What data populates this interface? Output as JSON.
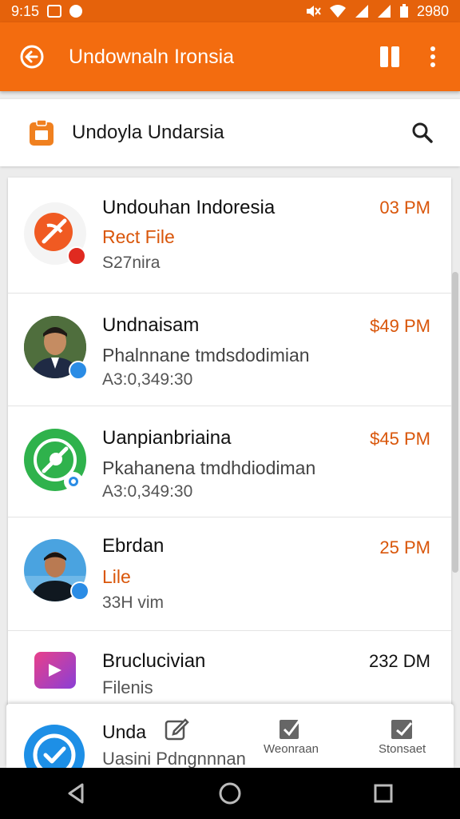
{
  "status_bar": {
    "time": "9:15",
    "battery": "2980"
  },
  "app_bar": {
    "title": "Undownaln Ironsia"
  },
  "search_bar": {
    "text": "Undoyla Undarsia"
  },
  "items": [
    {
      "name": "Undouhan Indoresia",
      "subtitle": "Rect File",
      "meta": "S27nira",
      "time": "03 PM"
    },
    {
      "name": "Undnaisam",
      "subtitle": "Phalnnane tmdsdodimian",
      "meta": "A3:0,349:30",
      "time": "$49 PM"
    },
    {
      "name": "Uanpianbriaina",
      "subtitle": "Pkahanena tmdhdiodiman",
      "meta": "A3:0,349:30",
      "time": "$45 PM"
    },
    {
      "name": "Ebrdan",
      "subtitle": "Lile",
      "meta": "33H vim",
      "time": "25 PM"
    },
    {
      "name": "Bruclucivian",
      "subtitle": "Filenis",
      "meta": "",
      "time": "232 DM"
    }
  ],
  "bottom_card": {
    "name": "Unda",
    "subtitle": "Uasini Pdngnnnan",
    "action_2_label": "Weonraan",
    "action_3_label": "Stonsaet"
  },
  "colors": {
    "accent": "#f36c0f",
    "time_orange": "#d9560a"
  },
  "icons": {
    "back": "arrow-left-circle-icon",
    "book": "book-icon",
    "more": "more-vert-icon",
    "search": "search-icon",
    "clipboard": "clipboard-icon"
  }
}
